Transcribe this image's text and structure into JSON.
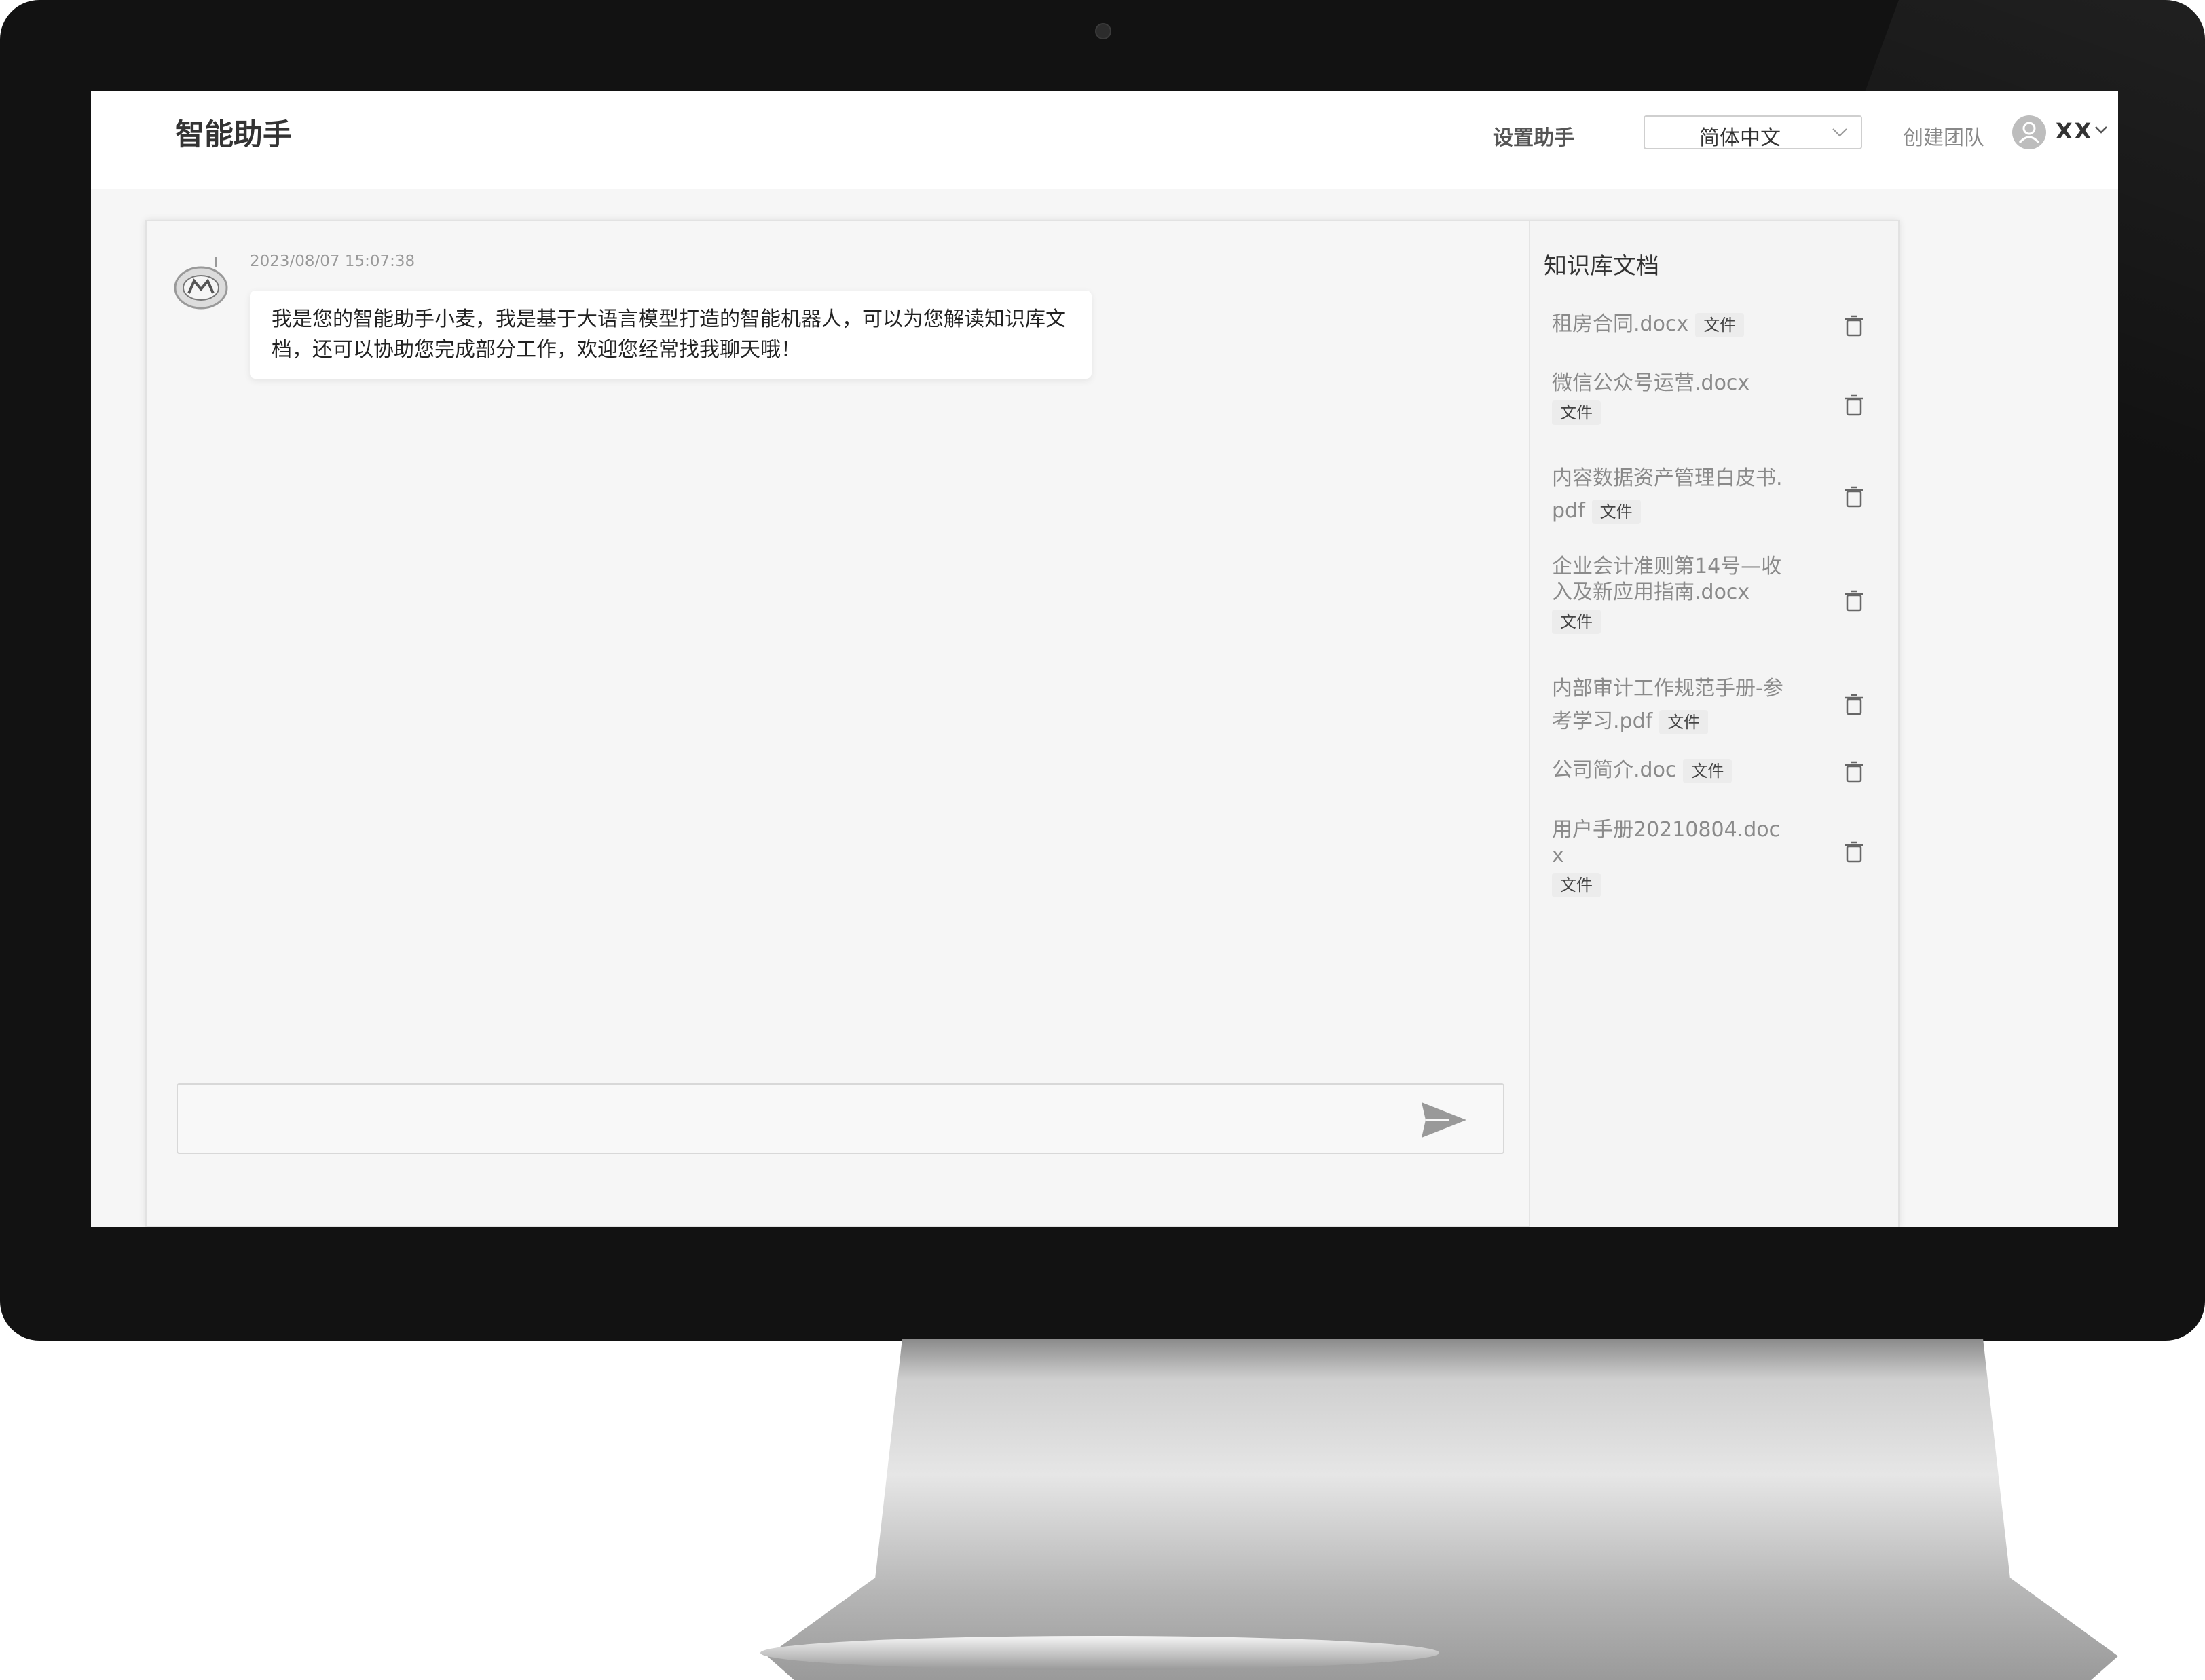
{
  "header": {
    "app_title": "智能助手",
    "setup_label": "设置助手",
    "language": "简体中文",
    "create_team_label": "创建团队",
    "user_name": "XX"
  },
  "chat": {
    "messages": [
      {
        "time": "2023/08/07 15:07:38",
        "text": "我是您的智能助手小麦，我是基于大语言模型打造的智能机器人，可以为您解读知识库文档，还可以协助您完成部分工作，欢迎您经常找我聊天哦！"
      }
    ],
    "input_value": "",
    "send_icon": "send-icon"
  },
  "knowledge_base": {
    "title": "知识库文档",
    "delete_icon": "trash-icon",
    "items": [
      {
        "name": "租房合同.docx",
        "tag": "文件"
      },
      {
        "name": "微信公众号运营.docx",
        "tag": "文件"
      },
      {
        "name": "内容数据资产管理白皮书.pdf",
        "tag": "文件"
      },
      {
        "name": "企业会计准则第14号—收入及新应用指南.docx",
        "tag": "文件"
      },
      {
        "name": "内部审计工作规范手册-参考学习.pdf",
        "tag": "文件"
      },
      {
        "name": "公司简介.doc",
        "tag": "文件"
      },
      {
        "name": "用户手册20210804.docx",
        "tag": "文件"
      }
    ]
  }
}
